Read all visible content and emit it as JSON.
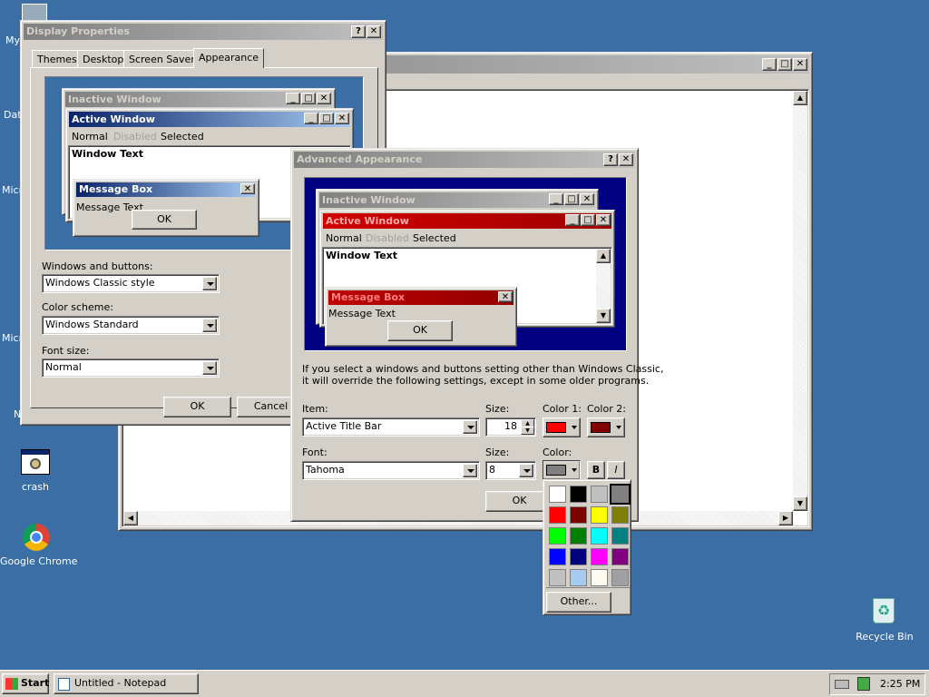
{
  "desktop": {
    "icons": [
      {
        "label": "My"
      },
      {
        "label": "Dat"
      },
      {
        "label": "Micr"
      },
      {
        "label": "Micr"
      },
      {
        "label": "N"
      },
      {
        "label": "crash"
      },
      {
        "label": "Google Chrome"
      },
      {
        "label": "Recycle Bin"
      }
    ]
  },
  "display_properties": {
    "title": "Display Properties",
    "tabs": [
      "Themes",
      "Desktop",
      "Screen Saver",
      "Appearance"
    ],
    "active_tab": "Appearance",
    "preview": {
      "inactive_title": "Inactive Window",
      "active_title": "Active Window",
      "menu_normal": "Normal",
      "menu_disabled": "Disabled",
      "menu_selected": "Selected",
      "window_text": "Window Text",
      "msgbox_title": "Message Box",
      "msgbox_text": "Message Text",
      "ok": "OK"
    },
    "windows_buttons_label": "Windows and buttons:",
    "windows_buttons_value": "Windows Classic style",
    "color_scheme_label": "Color scheme:",
    "color_scheme_value": "Windows Standard",
    "font_size_label": "Font size:",
    "font_size_value": "Normal",
    "ok": "OK",
    "cancel": "Cancel"
  },
  "advanced": {
    "title": "Advanced Appearance",
    "preview": {
      "inactive_title": "Inactive Window",
      "active_title": "Active Window",
      "menu_normal": "Normal",
      "menu_disabled": "Disabled",
      "menu_selected": "Selected",
      "window_text": "Window Text",
      "msgbox_title": "Message Box",
      "msgbox_text": "Message Text",
      "ok": "OK"
    },
    "info_line1": "If you select a windows and buttons setting other than Windows Classic,",
    "info_line2": "it will override the following settings, except in some older programs.",
    "item_label": "Item:",
    "item_value": "Active Title Bar",
    "size_label": "Size:",
    "size_value": "18",
    "color1_label": "Color 1:",
    "color2_label": "Color 2:",
    "font_label": "Font:",
    "font_value": "Tahoma",
    "font_size_label": "Size:",
    "font_size_value": "8",
    "color_label": "Color:",
    "bold": "B",
    "italic": "I",
    "ok": "OK",
    "color1": "#ff0000",
    "color2": "#800000",
    "color": "#808080"
  },
  "palette": {
    "colors": [
      "#ffffff",
      "#000000",
      "#c0c0c0",
      "#808080",
      "#ff0000",
      "#800000",
      "#ffff00",
      "#808000",
      "#00ff00",
      "#008000",
      "#00ffff",
      "#008080",
      "#0000ff",
      "#000080",
      "#ff00ff",
      "#800080",
      "#c0c0c0",
      "#a6caf0",
      "#fffbf0",
      "#a0a0a4"
    ],
    "other": "Other..."
  },
  "taskbar": {
    "start": "Start",
    "task": "Untitled - Notepad",
    "clock": "2:25 PM"
  }
}
